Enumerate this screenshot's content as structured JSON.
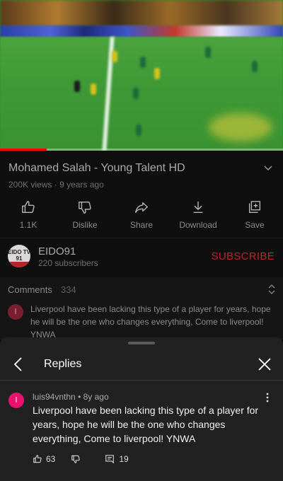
{
  "video": {
    "progress": 0.165,
    "progress_color": "#ff0000"
  },
  "title": "Mohamed Salah - Young Talent HD",
  "meta": {
    "views": "200K views",
    "separator": "·",
    "age": "9 years ago"
  },
  "actions": [
    {
      "icon": "thumbs-up-icon",
      "label": "1.1K"
    },
    {
      "icon": "thumbs-down-icon",
      "label": "Dislike"
    },
    {
      "icon": "share-icon",
      "label": "Share"
    },
    {
      "icon": "download-icon",
      "label": "Download"
    },
    {
      "icon": "save-icon",
      "label": "Save"
    }
  ],
  "channel": {
    "avatar_line1": "EIDO TV",
    "avatar_line2": "91",
    "name": "EIDO91",
    "subscribers": "220 subscribers",
    "subscribe_label": "SUBSCRIBE",
    "subscribe_color": "#c2232a"
  },
  "comments": {
    "heading": "Comments",
    "count": "334",
    "top_comment": {
      "avatar_letter": "l",
      "text": "Liverpool have been lacking this type of a player for years, hope he will be the one who changes everything, Come to liverpool! YNWA"
    }
  },
  "replies": {
    "title": "Replies",
    "comment": {
      "avatar_letter": "l",
      "avatar_color": "#e8136f",
      "author": "luis94vnthn",
      "separator": "•",
      "age": "8y ago",
      "text": "Liverpool have been lacking this type of a player for years, hope he will be the one who changes everything, Come to liverpool! YNWA",
      "likes": "63",
      "reply_count": "19"
    }
  }
}
